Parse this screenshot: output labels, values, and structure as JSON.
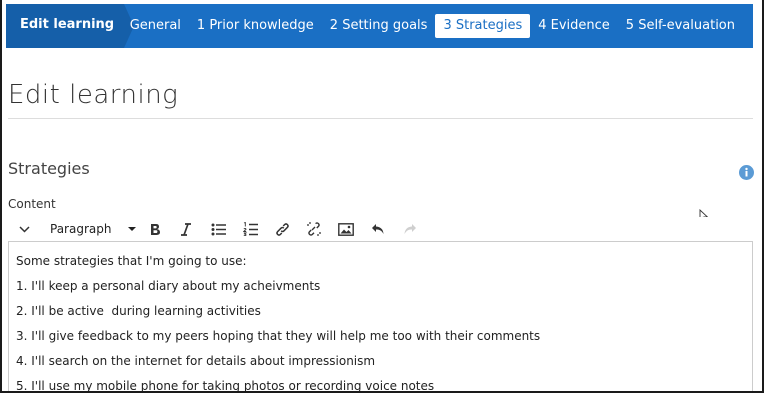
{
  "nav": {
    "crumb": "Edit learning",
    "tabs": [
      {
        "label": "General",
        "active": false
      },
      {
        "label": "1 Prior knowledge",
        "active": false
      },
      {
        "label": "2 Setting goals",
        "active": false
      },
      {
        "label": "3 Strategies",
        "active": true
      },
      {
        "label": "4 Evidence",
        "active": false
      },
      {
        "label": "5 Self-evaluation",
        "active": false
      }
    ]
  },
  "page": {
    "title": "Edit learning",
    "section_title": "Strategies",
    "field_label": "Content"
  },
  "toolbar": {
    "paragraph_format": "Paragraph",
    "buttons": [
      "collapse-toolbar",
      "bold",
      "italic",
      "bullet-list",
      "numbered-list",
      "link",
      "unlink",
      "image",
      "undo",
      "redo"
    ]
  },
  "editor": {
    "lines": [
      "Some strategies that I'm going to use:",
      "1. I'll keep a personal diary about my acheivments",
      "2. I'll be active  during learning activities",
      "3. I'll give feedback to my peers hoping that they will help me too with their comments",
      "4. I'll search on the internet for details about impressionism",
      "5. I'll use my mobile phone for taking photos or recording voice notes"
    ]
  },
  "colors": {
    "nav_bg": "#1a6fc4",
    "crumb_bg": "#155fa9",
    "info_icon": "#5b9bd5"
  }
}
